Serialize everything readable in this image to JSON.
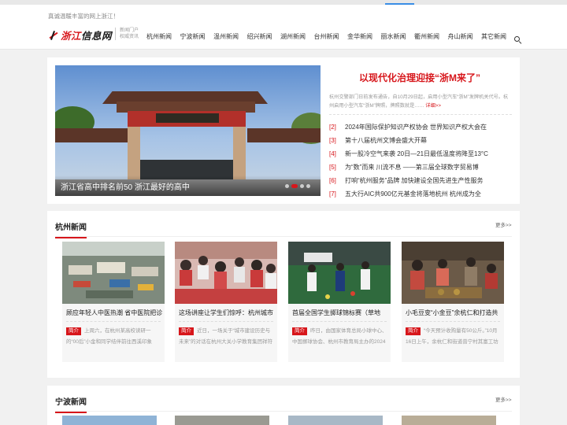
{
  "header": {
    "welcome": "真诚温暖丰富的网上浙江！",
    "logo_name_red": "浙江",
    "logo_name_rest": "信息网",
    "slogan_line1": "新闻门户",
    "slogan_line2": "权威资讯",
    "nav": [
      "杭州新闻",
      "宁波新闻",
      "温州新闻",
      "绍兴新闻",
      "湖州新闻",
      "台州新闻",
      "金华新闻",
      "丽水新闻",
      "衢州新闻",
      "舟山新闻",
      "其它新闻"
    ],
    "search_icon": "search-icon"
  },
  "hero": {
    "slide_caption": "浙江省高中排名前50 浙江最好的高中",
    "active_slide": 2,
    "slide_count": 4,
    "headline": "以现代化治理迎接“浙M来了”",
    "summary": "杭州交警部门日前发布通告，自10月29日起，启用小型汽车“浙M”发牌机关代号。杭州启用小型汽车“浙M”牌照，牌照数就是……",
    "summary_more": "详细>>",
    "list": [
      {
        "num": "[2]",
        "title": "2024年国际保护知识产权协会 世界知识产权大会在"
      },
      {
        "num": "[3]",
        "title": "第十八届杭州文博会盛大开幕"
      },
      {
        "num": "[4]",
        "title": "新一股冷空气来袭 20日—21日最低温度将降至13°C"
      },
      {
        "num": "[5]",
        "title": "为“数”而来 川流不息 ——第三届全球数字贸易博"
      },
      {
        "num": "[6]",
        "title": "打响“杭州服务”品牌 加快建设全国先进生产性服务"
      },
      {
        "num": "[7]",
        "title": "五大行AIC共900亿元基金将落地杭州 杭州成为全"
      }
    ]
  },
  "hangzhou": {
    "title": "杭州新闻",
    "more": "更多>>",
    "tag": "简介",
    "items": [
      {
        "title": "顾应年轻人中医热潮 省中医院把诊",
        "desc": "上周六，在杭州某高校读研一的“00后”小金和同学结伴前往西溪印象城，几人“逛吃玩”后，还..."
      },
      {
        "title": "这场讲座让学生们惊呼：杭州城市",
        "desc": "近日，一场关于“城市建设历史与未来”的对话在杭州大关小学教育集团祥符校区进行，一张张解说..."
      },
      {
        "title": "首届全国学生掷球锦标赛（草地",
        "desc": "昨日，由国家体育总局小球中心、中国掷球协会、杭州市教育局主办的2024年全国学生掷球锦标..."
      },
      {
        "title": "小毛豆变“小金豆”余杭仁和打造共",
        "desc": "“今天预计收购量有50公斤。”10月16日上午，余杭仁和街道普宁村其富工坊门口排起了长..."
      }
    ]
  },
  "ningbo": {
    "title": "宁波新闻",
    "more": "更多>>"
  },
  "colors": {
    "accent": "#d7161b",
    "background": "#f1f1f1"
  }
}
